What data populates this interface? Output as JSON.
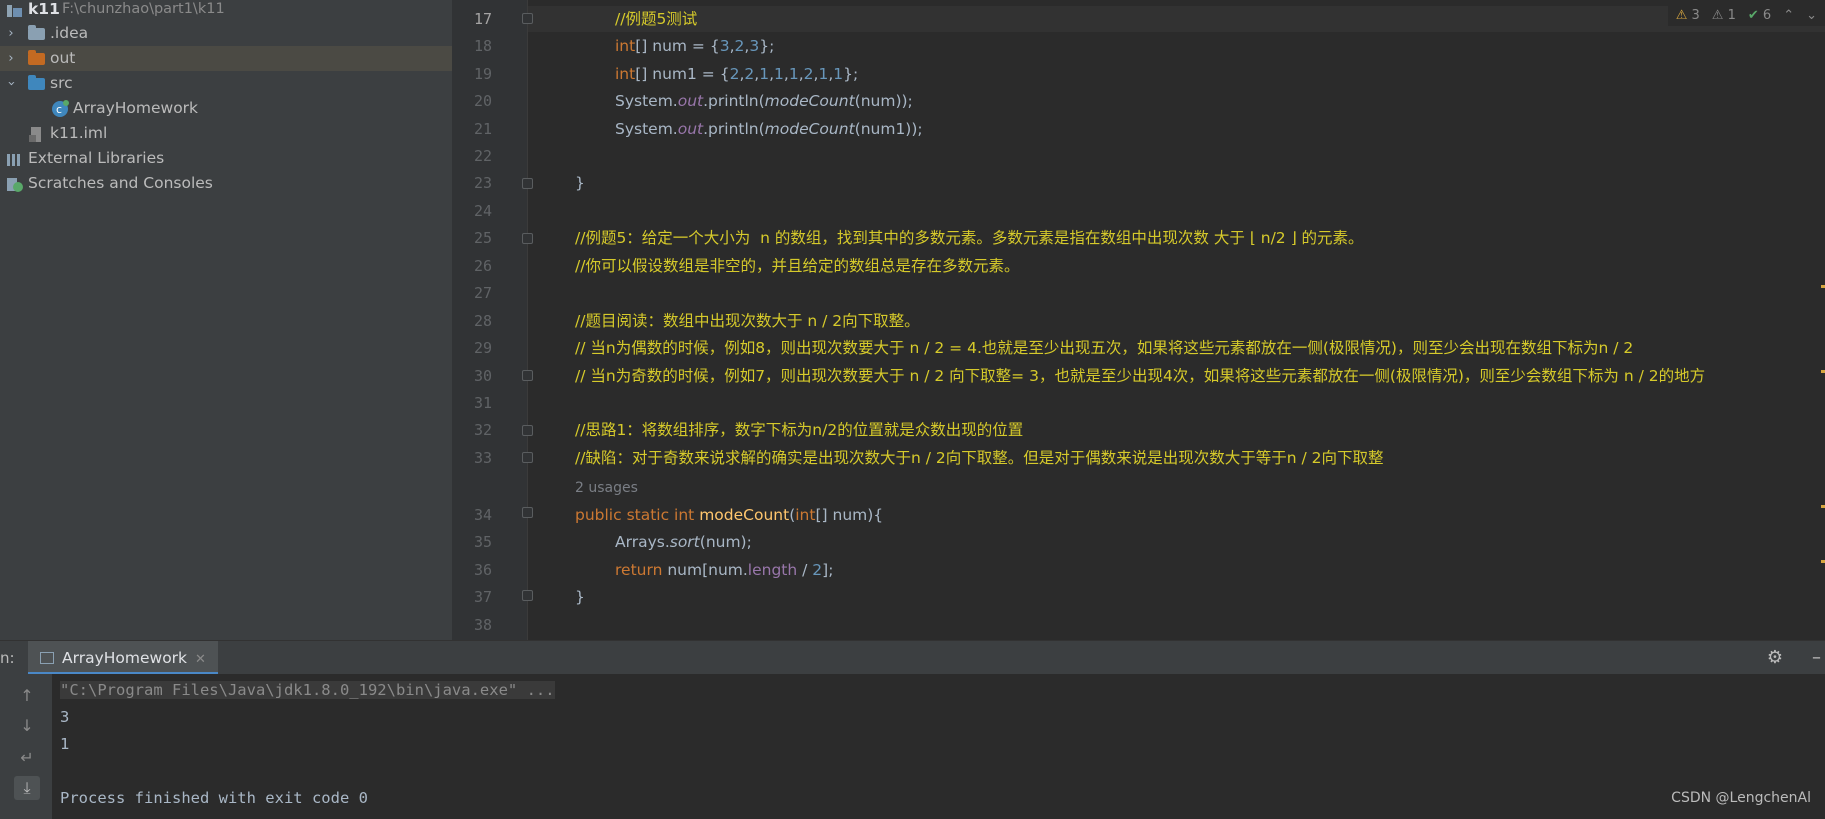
{
  "project": {
    "root_name": "k11",
    "root_path": "F:\\chunzhao\\part1\\k11",
    "items": [
      {
        "label": ".idea"
      },
      {
        "label": "out"
      },
      {
        "label": "src"
      },
      {
        "label": "ArrayHomework"
      },
      {
        "label": "k11.iml"
      },
      {
        "label": "External Libraries"
      },
      {
        "label": "Scratches and Consoles"
      }
    ]
  },
  "editor": {
    "inspections": {
      "warnings": "3",
      "weak_warnings": "1",
      "ok": "6"
    },
    "usages_hint": "2 usages",
    "line_numbers": [
      "17",
      "18",
      "19",
      "20",
      "21",
      "22",
      "23",
      "24",
      "25",
      "26",
      "27",
      "28",
      "29",
      "30",
      "31",
      "32",
      "33",
      "34",
      "35",
      "36",
      "37",
      "38"
    ],
    "lines": {
      "l17": "//例题5测试",
      "l18_kw": "int",
      "l18_rest": "[] num = {",
      "l18_n1": "3",
      "l18_n2": "2",
      "l18_n3": "3",
      "l19_kw": "int",
      "l19_rest": "[] num1 = {",
      "l19_nums": [
        "2",
        "2",
        "1",
        "1",
        "1",
        "2",
        "1",
        "1"
      ],
      "l20_a": "System.",
      "l20_field": "out",
      "l20_b": ".println(",
      "l20_fn": "modeCount",
      "l20_c": "(num));",
      "l21_a": "System.",
      "l21_field": "out",
      "l21_b": ".println(",
      "l21_fn": "modeCount",
      "l21_c": "(num1));",
      "l23": "}",
      "l25": "//例题5：给定一个大小为  n 的数组，找到其中的多数元素。多数元素是指在数组中出现次数 大于 ⌊ n/2 ⌋ 的元素。",
      "l26": "//你可以假设数组是非空的，并且给定的数组总是存在多数元素。",
      "l28": "//题目阅读：数组中出现次数大于 n / 2向下取整。",
      "l29": "// 当n为偶数的时候，例如8，则出现次数要大于 n / 2 = 4.也就是至少出现五次，如果将这些元素都放在一侧(极限情况)，则至少会出现在数组下标为n / 2",
      "l30": "// 当n为奇数的时候，例如7，则出现次数要大于 n / 2 向下取整= 3，也就是至少出现4次，如果将这些元素都放在一侧(极限情况)，则至少会数组下标为 n / 2的地方",
      "l32": "//思路1：将数组排序，数字下标为n/2的位置就是众数出现的位置",
      "l33": "//缺陷：对于奇数来说求解的确实是出现次数大于n / 2向下取整。但是对于偶数来说是出现次数大于等于n / 2向下取整",
      "l34_kw": "public static int ",
      "l34_fn": "modeCount",
      "l34_a": "(",
      "l34_kw2": "int",
      "l34_b": "[] num){",
      "l35_a": "Arrays.",
      "l35_fn": "sort",
      "l35_b": "(num);",
      "l36_kw": "return ",
      "l36_a": "num[num.",
      "l36_field": "length",
      "l36_b": " / ",
      "l36_num": "2",
      "l36_c": "];",
      "l37": "}"
    }
  },
  "run": {
    "title": "n:",
    "tab_label": "ArrayHomework",
    "output": [
      "\"C:\\Program Files\\Java\\jdk1.8.0_192\\bin\\java.exe\" ...",
      "3",
      "1",
      "",
      "Process finished with exit code 0"
    ]
  },
  "watermark": "CSDN @LengchenAl",
  "colors": {
    "comment": "#d6ca2b",
    "keyword": "#cc7832",
    "number": "#6897bb",
    "method": "#ffc66d",
    "field": "#9876aa"
  }
}
